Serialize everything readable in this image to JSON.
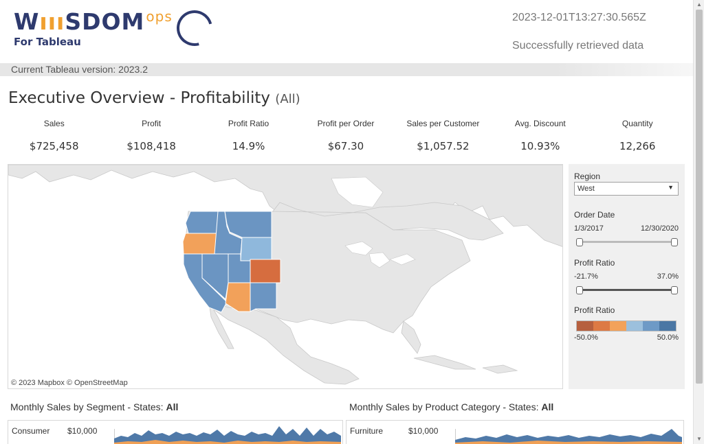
{
  "header": {
    "logo_text": "W",
    "logo_rest": "SDOM",
    "logo_ops": "ops",
    "logo_sub": "For Tableau",
    "timestamp": "2023-12-01T13:27:30.565Z",
    "status": "Successfully retrieved data",
    "version": "Current Tableau version: 2023.2"
  },
  "dashboard": {
    "title": "Executive Overview - Profitability",
    "title_filter": "(All)"
  },
  "kpis": [
    {
      "label": "Sales",
      "value": "$725,458"
    },
    {
      "label": "Profit",
      "value": "$108,418"
    },
    {
      "label": "Profit Ratio",
      "value": "14.9%"
    },
    {
      "label": "Profit per Order",
      "value": "$67.30"
    },
    {
      "label": "Sales per Customer",
      "value": "$1,057.52"
    },
    {
      "label": "Avg. Discount",
      "value": "10.93%"
    },
    {
      "label": "Quantity",
      "value": "12,266"
    }
  ],
  "map": {
    "credit": "© 2023 Mapbox  © OpenStreetMap"
  },
  "filters": {
    "region_label": "Region",
    "region_value": "West",
    "order_date_label": "Order Date",
    "order_date_start": "1/3/2017",
    "order_date_end": "12/30/2020",
    "profit_ratio_label": "Profit Ratio",
    "profit_ratio_min": "-21.7%",
    "profit_ratio_max": "37.0%",
    "legend_label": "Profit Ratio",
    "legend_min": "-50.0%",
    "legend_max": "50.0%",
    "legend_colors": [
      "#b6603f",
      "#dd7a45",
      "#f3a25a",
      "#9cc0dd",
      "#6e9ac6",
      "#4b77a4"
    ]
  },
  "sections": {
    "segment_title": "Monthly Sales by Segment - States:",
    "segment_states": "All",
    "segment_row_label": "Consumer",
    "segment_row_value": "$10,000",
    "category_title": "Monthly Sales by Product Category - States:",
    "category_states": "All",
    "category_row_label": "Furniture",
    "category_row_value": "$10,000"
  },
  "colors": {
    "blue": "#5b86b5",
    "orange": "#f0a055",
    "dark_orange": "#d66d3f",
    "light_blue": "#8fb8dc"
  }
}
